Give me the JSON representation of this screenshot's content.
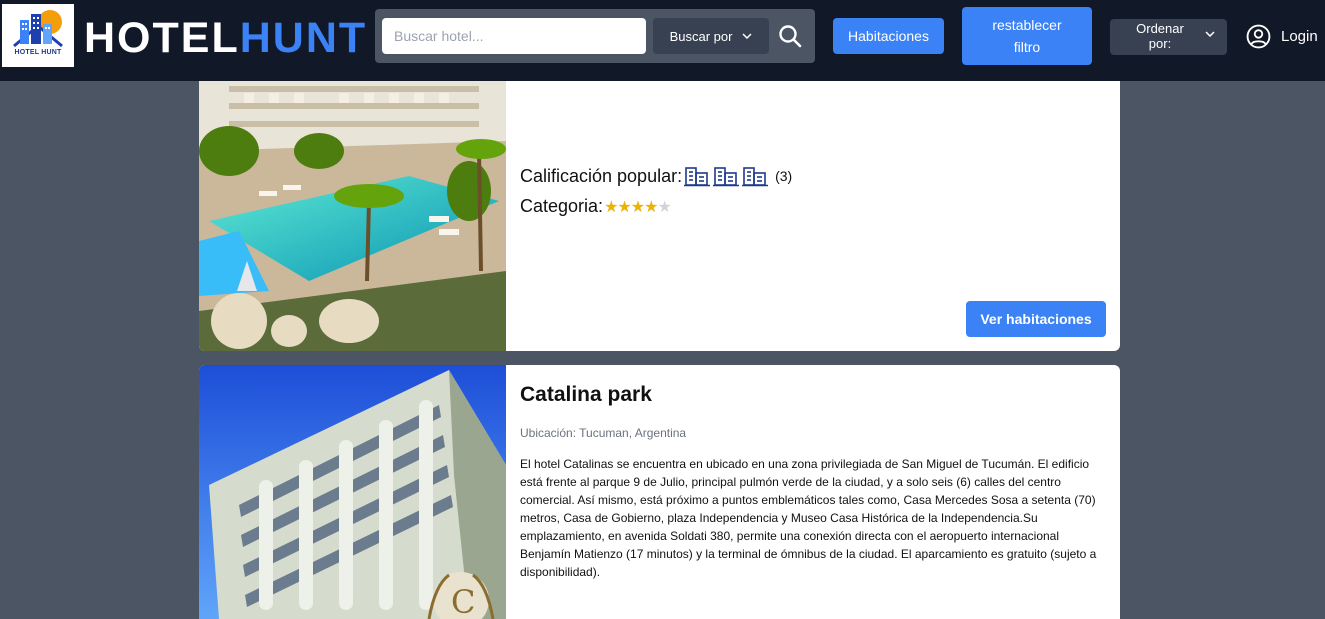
{
  "header": {
    "logo_caption": "HOTEL HUNT",
    "brand_part1": "HOTEL",
    "brand_part2": "HUNT",
    "search_placeholder": "Buscar hotel...",
    "search_by_label": "Buscar por",
    "rooms_button": "Habitaciones",
    "reset_filter_button": "restablecer filtro",
    "sort_label": "Ordenar por:",
    "login_label": "Login"
  },
  "hotels": [
    {
      "rating_label": "Calificación popular:",
      "rating_icons": 3,
      "rating_count": "(3)",
      "category_label": "Categoria:",
      "category_stars": 4,
      "category_max": 5,
      "view_button": "Ver habitaciones"
    },
    {
      "name": "Catalina park",
      "location": "Ubicación: Tucuman, Argentina",
      "description": "El hotel Catalinas se encuentra en ubicado en una zona privilegiada de San Miguel de Tucumán. El edificio está frente al parque 9 de Julio, principal pulmón verde de la ciudad, y a solo seis (6) calles del centro comercial. Así mismo, está próximo a puntos emblemáticos tales como, Casa Mercedes Sosa a setenta (70) metros, Casa de Gobierno, plaza Independencia y Museo Casa Histórica de la Independencia.Su emplazamiento, en avenida Soldati 380, permite una conexión directa con el aeropuerto internacional Benjamín Matienzo (17 minutos) y la terminal de ómnibus de la ciudad. El aparcamiento es gratuito (sujeto a disponibilidad)."
    }
  ],
  "colors": {
    "header_bg": "#111827",
    "page_bg": "#4b5563",
    "accent": "#3b82f6",
    "star": "#eab308",
    "building_icon": "#1e3a8a"
  },
  "icons": [
    "search-icon",
    "chevron-down-icon",
    "user-circle-icon",
    "building-icon",
    "star-icon"
  ]
}
